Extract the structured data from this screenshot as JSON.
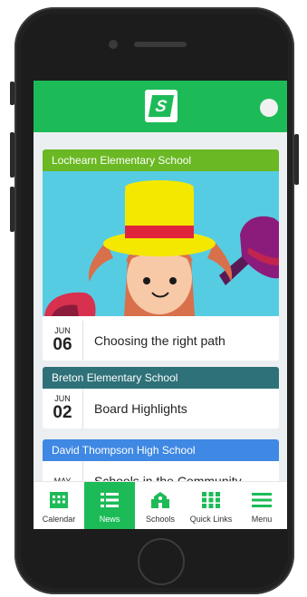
{
  "theme": {
    "accent": "#1dbb58"
  },
  "header": {
    "logo_letter": "S",
    "icon": "bell-icon"
  },
  "news": [
    {
      "school": "Lochearn Elementary School",
      "color": "#6ab823",
      "month": "JUN",
      "day": "06",
      "title": "Choosing the right path"
    },
    {
      "school": "Breton Elementary School",
      "color": "#2e7178",
      "month": "JUN",
      "day": "02",
      "title": "Board Highlights"
    },
    {
      "school": "David Thompson High School",
      "color": "#3f88e3",
      "month": "MAY",
      "day": "",
      "title": "Schools in the Community"
    }
  ],
  "tabs": [
    {
      "label": "Calendar",
      "icon": "calendar-icon"
    },
    {
      "label": "News",
      "icon": "news-list-icon",
      "active": true
    },
    {
      "label": "Schools",
      "icon": "school-icon"
    },
    {
      "label": "Quick Links",
      "icon": "grid-icon"
    },
    {
      "label": "Menu",
      "icon": "hamburger-icon"
    }
  ]
}
